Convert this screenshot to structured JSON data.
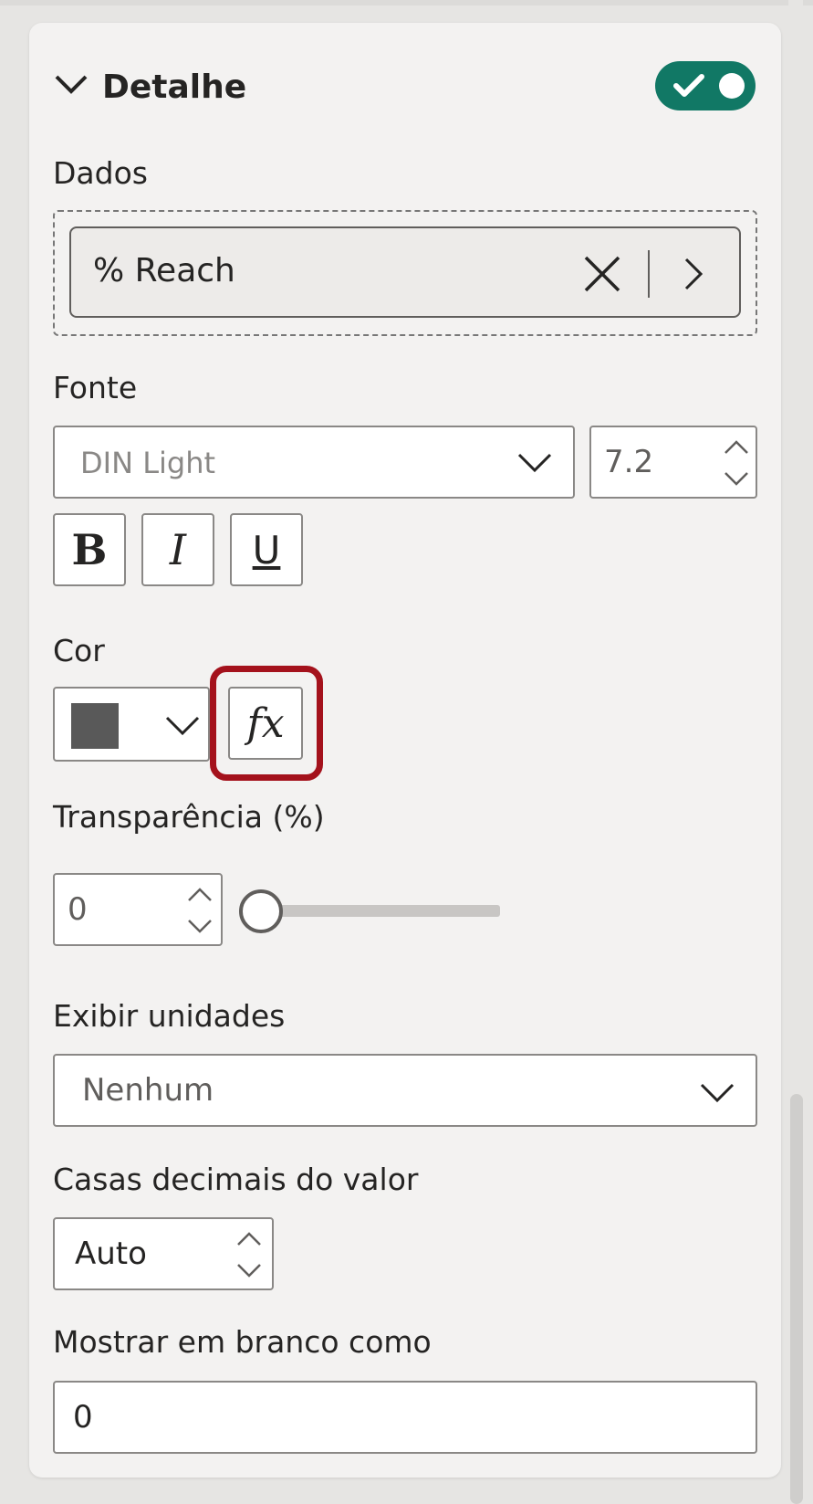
{
  "section": {
    "title": "Detalhe",
    "enabled": true
  },
  "data_well": {
    "label": "Dados",
    "field": "% Reach"
  },
  "font": {
    "label": "Fonte",
    "family": "DIN Light",
    "size": "7.2",
    "bold_label": "B",
    "italic_label": "I",
    "underline_label": "U"
  },
  "color": {
    "label": "Cor",
    "swatch": "#595959",
    "fx_label": "fx",
    "highlight": "#a4121c"
  },
  "transparency": {
    "label": "Transparência (%)",
    "value": "0",
    "slider_percent": 0
  },
  "display_units": {
    "label": "Exibir unidades",
    "value": "Nenhum"
  },
  "decimals": {
    "label": "Casas decimais do valor",
    "value": "Auto"
  },
  "blank": {
    "label": "Mostrar em branco como",
    "value": "0"
  },
  "theme": {
    "toggle_on": "#117865",
    "panel_bg": "#f3f2f1"
  }
}
